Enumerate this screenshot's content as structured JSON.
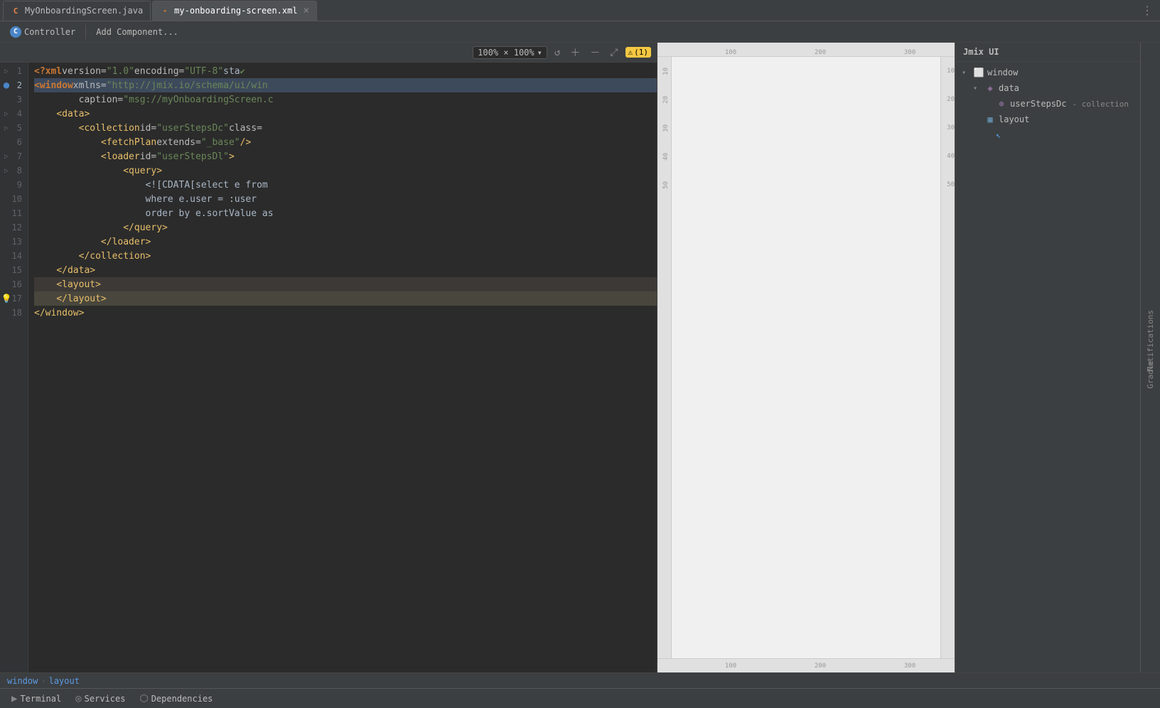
{
  "tabs": [
    {
      "id": "java-tab",
      "label": "MyOnboardingScreen.java",
      "icon": "java",
      "active": false,
      "closable": false
    },
    {
      "id": "xml-tab",
      "label": "my-onboarding-screen.xml",
      "icon": "xml",
      "active": true,
      "closable": true
    }
  ],
  "toolbar": {
    "controller_label": "Controller",
    "add_component_label": "Add Component..."
  },
  "editor_toolbar": {
    "zoom": "100% × 100%",
    "warning_count": "(1)"
  },
  "code_lines": [
    {
      "num": 1,
      "content": "<?xml version=\"1.0\" encoding=\"UTF-8\" sta",
      "type": "normal",
      "has_checkmark": true,
      "gutter": "fold"
    },
    {
      "num": 2,
      "content": "<window xmlns=\"http://jmix.io/schema/ui/win",
      "type": "normal",
      "has_error": true,
      "gutter": "fold",
      "active": true
    },
    {
      "num": 3,
      "content": "        caption=\"msg://myOnboardingScreen.c",
      "type": "normal"
    },
    {
      "num": 4,
      "content": "    <data>",
      "type": "tag",
      "gutter": "fold"
    },
    {
      "num": 5,
      "content": "        <collection id=\"userStepsDc\" class=",
      "type": "tag",
      "gutter": "fold"
    },
    {
      "num": 6,
      "content": "            <fetchPlan extends=\"_base\"/>",
      "type": "tag"
    },
    {
      "num": 7,
      "content": "            <loader id=\"userStepsDl\">",
      "type": "tag",
      "gutter": "fold"
    },
    {
      "num": 8,
      "content": "                <query>",
      "type": "tag",
      "gutter": "fold"
    },
    {
      "num": 9,
      "content": "                    <![CDATA[select e from",
      "type": "normal"
    },
    {
      "num": 10,
      "content": "                    where e.user = :user",
      "type": "normal"
    },
    {
      "num": 11,
      "content": "                    order by e.sortValue as",
      "type": "normal"
    },
    {
      "num": 12,
      "content": "                </query>",
      "type": "tag"
    },
    {
      "num": 13,
      "content": "            </loader>",
      "type": "tag"
    },
    {
      "num": 14,
      "content": "        </collection>",
      "type": "tag"
    },
    {
      "num": 15,
      "content": "    </data>",
      "type": "tag"
    },
    {
      "num": 16,
      "content": "    <layout>",
      "type": "tag",
      "highlighted": true
    },
    {
      "num": 17,
      "content": "    </layout>",
      "type": "tag",
      "highlighted2": true,
      "gutter": "lightbulb"
    },
    {
      "num": 18,
      "content": "</window>",
      "type": "tag"
    }
  ],
  "preview": {
    "ruler_marks_top": [
      "100",
      "200",
      "300"
    ],
    "ruler_marks_left": [
      "10",
      "20",
      "30",
      "40",
      "50"
    ],
    "ruler_marks_right": [
      "10",
      "20",
      "30",
      "40",
      "50"
    ]
  },
  "jmix_panel": {
    "title": "Jmix UI",
    "tree": [
      {
        "id": "window",
        "label": "window",
        "level": 1,
        "expanded": true,
        "icon": "window"
      },
      {
        "id": "data",
        "label": "data",
        "level": 2,
        "expanded": true,
        "icon": "data"
      },
      {
        "id": "userStepsDc",
        "label": "userStepsDc",
        "suffix": "- collection",
        "level": 3,
        "icon": "collection"
      },
      {
        "id": "layout",
        "label": "layout",
        "level": 2,
        "icon": "layout",
        "selected": false
      }
    ]
  },
  "right_sidebar": {
    "items": [
      "Notifications",
      "Gradle"
    ]
  },
  "breadcrumb": {
    "items": [
      "window",
      "layout"
    ]
  },
  "status_bar": {
    "terminal_label": "Terminal",
    "services_label": "Services",
    "dependencies_label": "Dependencies"
  }
}
